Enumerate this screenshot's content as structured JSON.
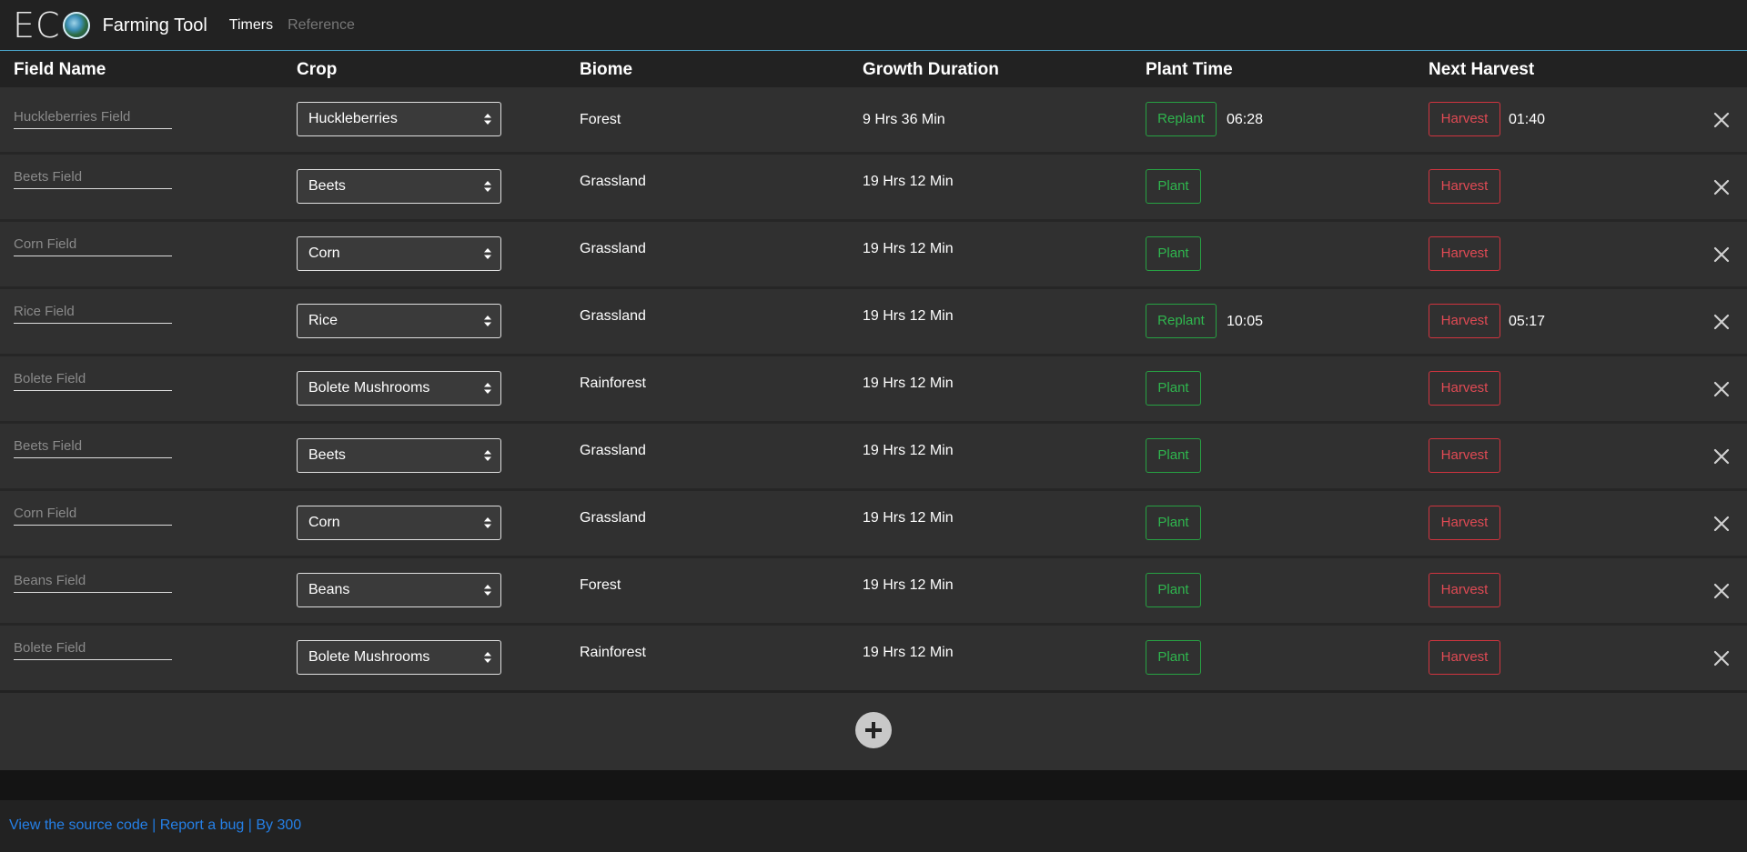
{
  "nav": {
    "logo_letters": [
      "E",
      "C"
    ],
    "brand": "Farming Tool",
    "links": [
      {
        "label": "Timers",
        "active": true
      },
      {
        "label": "Reference",
        "active": false
      }
    ]
  },
  "table": {
    "headers": [
      "Field Name",
      "Crop",
      "Biome",
      "Growth Duration",
      "Plant Time",
      "Next Harvest"
    ],
    "rows": [
      {
        "field": "Huckleberries Field",
        "crop": "Huckleberries",
        "biome": "Forest",
        "duration": "9 Hrs 36 Min",
        "plant_label": "Replant",
        "plant_time": "06:28",
        "harvest_label": "Harvest",
        "harvest_time": "01:40"
      },
      {
        "field": "Beets Field",
        "crop": "Beets",
        "biome": "Grassland",
        "duration": "19 Hrs 12 Min",
        "plant_label": "Plant",
        "plant_time": "",
        "harvest_label": "Harvest",
        "harvest_time": ""
      },
      {
        "field": "Corn Field",
        "crop": "Corn",
        "biome": "Grassland",
        "duration": "19 Hrs 12 Min",
        "plant_label": "Plant",
        "plant_time": "",
        "harvest_label": "Harvest",
        "harvest_time": ""
      },
      {
        "field": "Rice Field",
        "crop": "Rice",
        "biome": "Grassland",
        "duration": "19 Hrs 12 Min",
        "plant_label": "Replant",
        "plant_time": "10:05",
        "harvest_label": "Harvest",
        "harvest_time": "05:17"
      },
      {
        "field": "Bolete Field",
        "crop": "Bolete Mushrooms",
        "biome": "Rainforest",
        "duration": "19 Hrs 12 Min",
        "plant_label": "Plant",
        "plant_time": "",
        "harvest_label": "Harvest",
        "harvest_time": ""
      },
      {
        "field": "Beets Field",
        "crop": "Beets",
        "biome": "Grassland",
        "duration": "19 Hrs 12 Min",
        "plant_label": "Plant",
        "plant_time": "",
        "harvest_label": "Harvest",
        "harvest_time": ""
      },
      {
        "field": "Corn Field",
        "crop": "Corn",
        "biome": "Grassland",
        "duration": "19 Hrs 12 Min",
        "plant_label": "Plant",
        "plant_time": "",
        "harvest_label": "Harvest",
        "harvest_time": ""
      },
      {
        "field": "Beans Field",
        "crop": "Beans",
        "biome": "Forest",
        "duration": "19 Hrs 12 Min",
        "plant_label": "Plant",
        "plant_time": "",
        "harvest_label": "Harvest",
        "harvest_time": ""
      },
      {
        "field": "Bolete Field",
        "crop": "Bolete Mushrooms",
        "biome": "Rainforest",
        "duration": "19 Hrs 12 Min",
        "plant_label": "Plant",
        "plant_time": "",
        "harvest_label": "Harvest",
        "harvest_time": ""
      }
    ]
  },
  "icons": {
    "remove": "close-icon",
    "add": "plus-icon",
    "select": "sort-arrows-icon"
  },
  "footer": {
    "source_link": "View the source code",
    "separator": "|",
    "bug_link": "Report a bug",
    "author": "By 300"
  },
  "colors": {
    "plant": "#2fb64e",
    "harvest": "#e04a54",
    "link": "#2580e8",
    "navbar_border": "#4aa3c7"
  }
}
